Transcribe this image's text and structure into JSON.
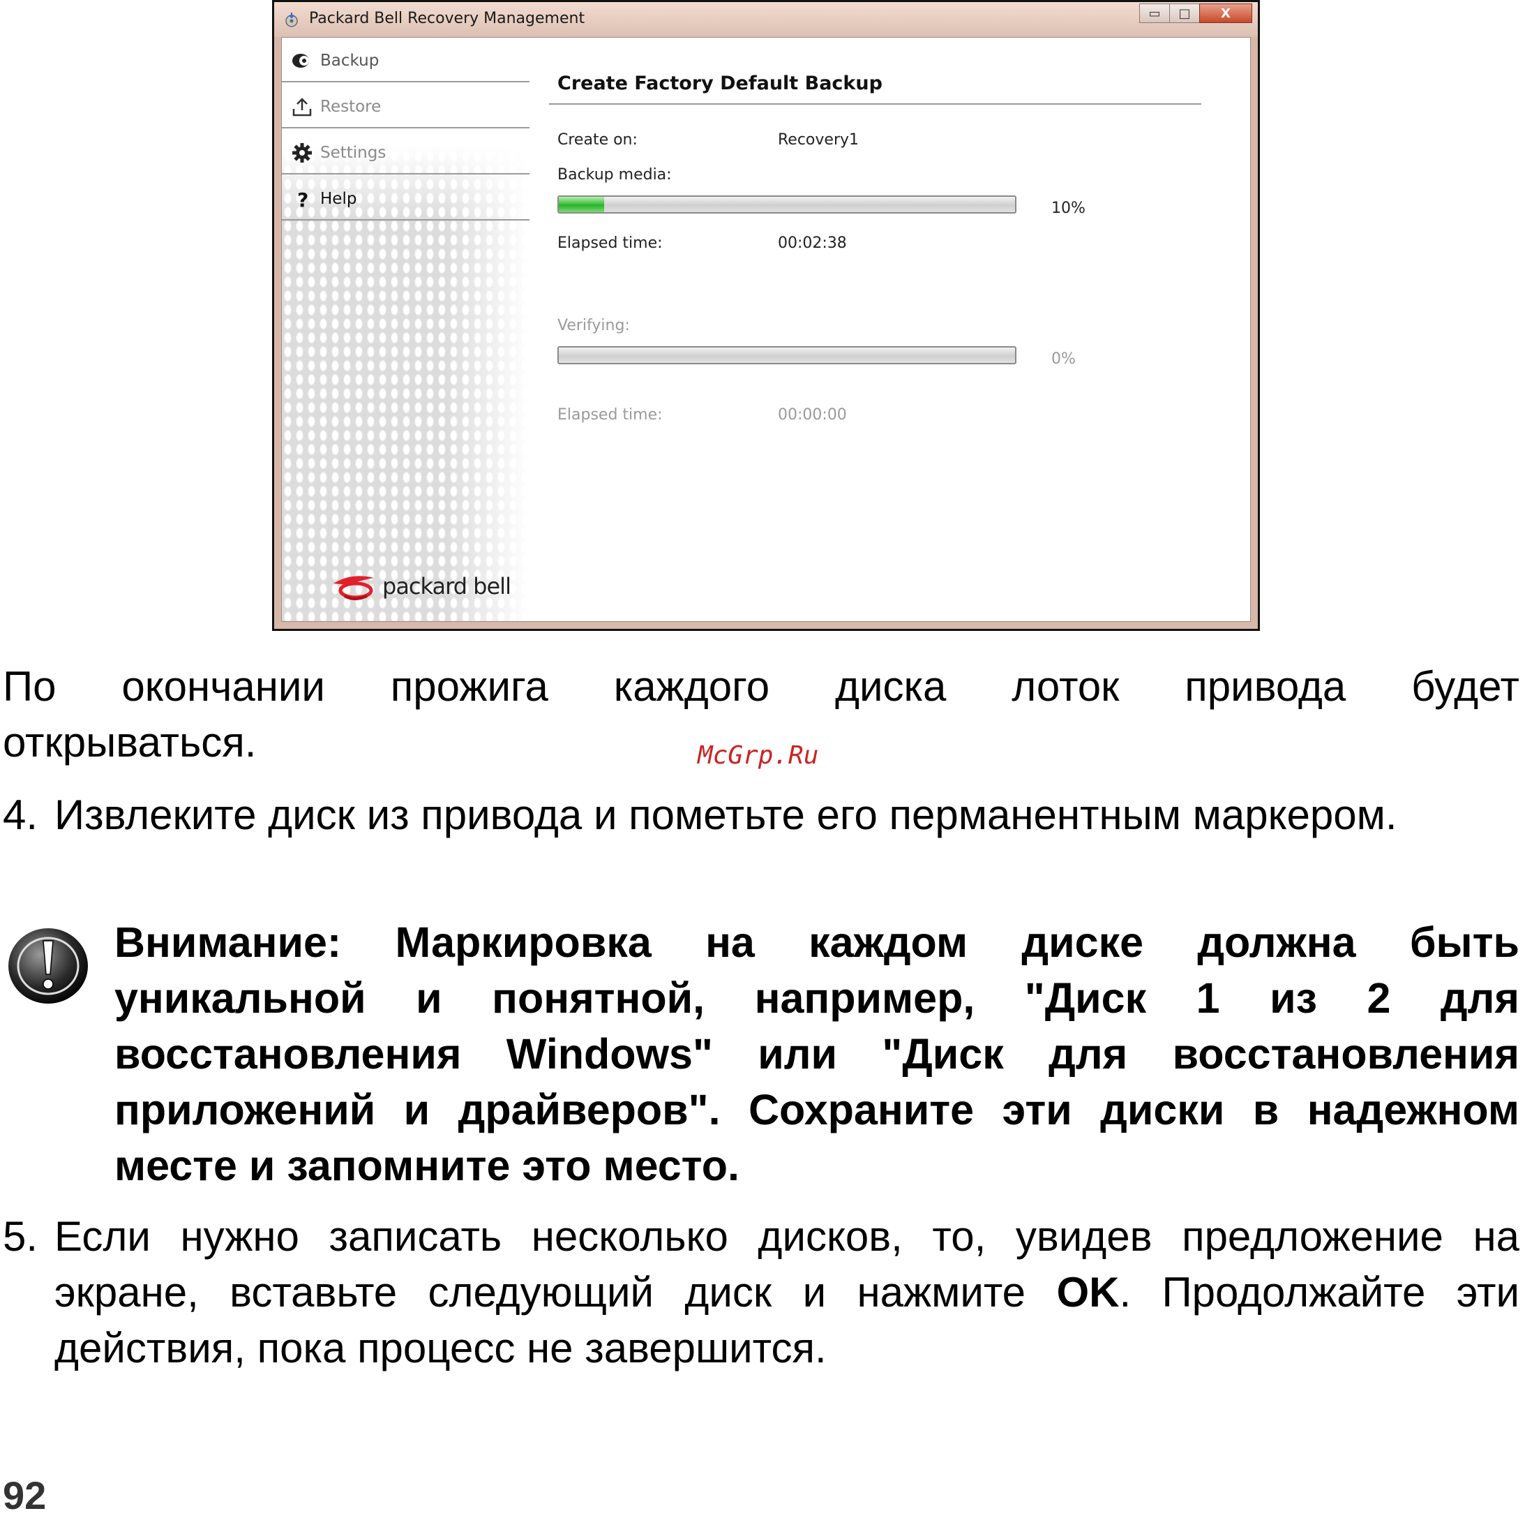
{
  "window": {
    "title": "Packard Bell Recovery Management",
    "buttons": {
      "minimize": "▭",
      "maximize": "□",
      "close": "X"
    },
    "sidebar": {
      "items": [
        {
          "label": "Backup",
          "icon": "backup-icon"
        },
        {
          "label": "Restore",
          "icon": "restore-icon"
        },
        {
          "label": "Settings",
          "icon": "gear-icon"
        },
        {
          "label": "Help",
          "icon": "help-icon"
        }
      ],
      "logo_text": "packard bell"
    },
    "main": {
      "heading": "Create Factory Default Backup",
      "create_on_label": "Create on:",
      "create_on_value": "Recovery1",
      "backup_media_label": "Backup media:",
      "backup_progress_text": "10%",
      "backup_progress": 0.1,
      "elapsed_label_1": "Elapsed time:",
      "elapsed_value_1": "00:02:38",
      "verifying_label": "Verifying:",
      "verify_progress_text": "0%",
      "verify_progress": 0.0,
      "elapsed_label_2": "Elapsed time:",
      "elapsed_value_2": "00:00:00"
    },
    "colors": {
      "progress_fill": "#29b52a",
      "close_button": "#c8492a"
    }
  },
  "document": {
    "para_line1": "По окончании прожига каждого диска лоток привода будет",
    "para_line2": "открываться.",
    "watermark": "McGrp.Ru",
    "step4_num": "4.",
    "step4_text": "Извлеките диск из привода и пометьте его перманентным маркером.",
    "warning_text": "Внимание: Маркировка на каждом диске должна быть уникальной и понятной, например, \"Диск 1 из 2 для восстановления Windows\" или \"Диск для восстановления приложений и драйверов\". Сохраните эти диски в надежном месте и запомните это место.",
    "step5_num": "5.",
    "step5_before": "Если нужно записать несколько дисков, то, увидев предложение на экране, вставьте следующий диск и нажмите ",
    "step5_bold": "OK",
    "step5_after": ". Продолжайте эти действия, пока процесс не завершится.",
    "page_number": "92"
  }
}
